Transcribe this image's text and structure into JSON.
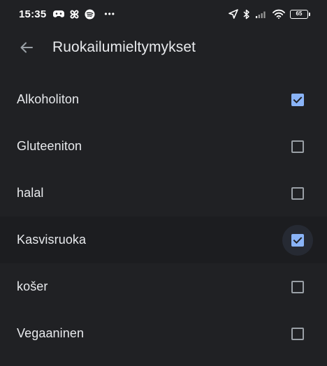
{
  "status_bar": {
    "time": "15:35",
    "overflow": "•••",
    "battery_level": "65",
    "left_icons": [
      "game-controller-icon",
      "pinwheel-icon",
      "spotify-icon"
    ],
    "right_icons": [
      "location-arrow-icon",
      "bluetooth-icon",
      "cellular-signal-icon",
      "wifi-icon",
      "battery-icon"
    ]
  },
  "app_bar": {
    "back_icon": "arrow-left-icon",
    "title": "Ruokailumieltymykset"
  },
  "preferences": [
    {
      "label": "Alkoholiton",
      "checked": true
    },
    {
      "label": "Gluteeniton",
      "checked": false
    },
    {
      "label": "halal",
      "checked": false
    },
    {
      "label": "Kasvisruoka",
      "checked": true,
      "focused": true
    },
    {
      "label": "košer",
      "checked": false
    },
    {
      "label": "Vegaaninen",
      "checked": false
    }
  ],
  "colors": {
    "background": "#202124",
    "text": "#e8eaed",
    "checkbox_accent": "#8ab4f8",
    "checkbox_unchecked_border": "#9aa0a6",
    "checkmark": "#202124"
  }
}
